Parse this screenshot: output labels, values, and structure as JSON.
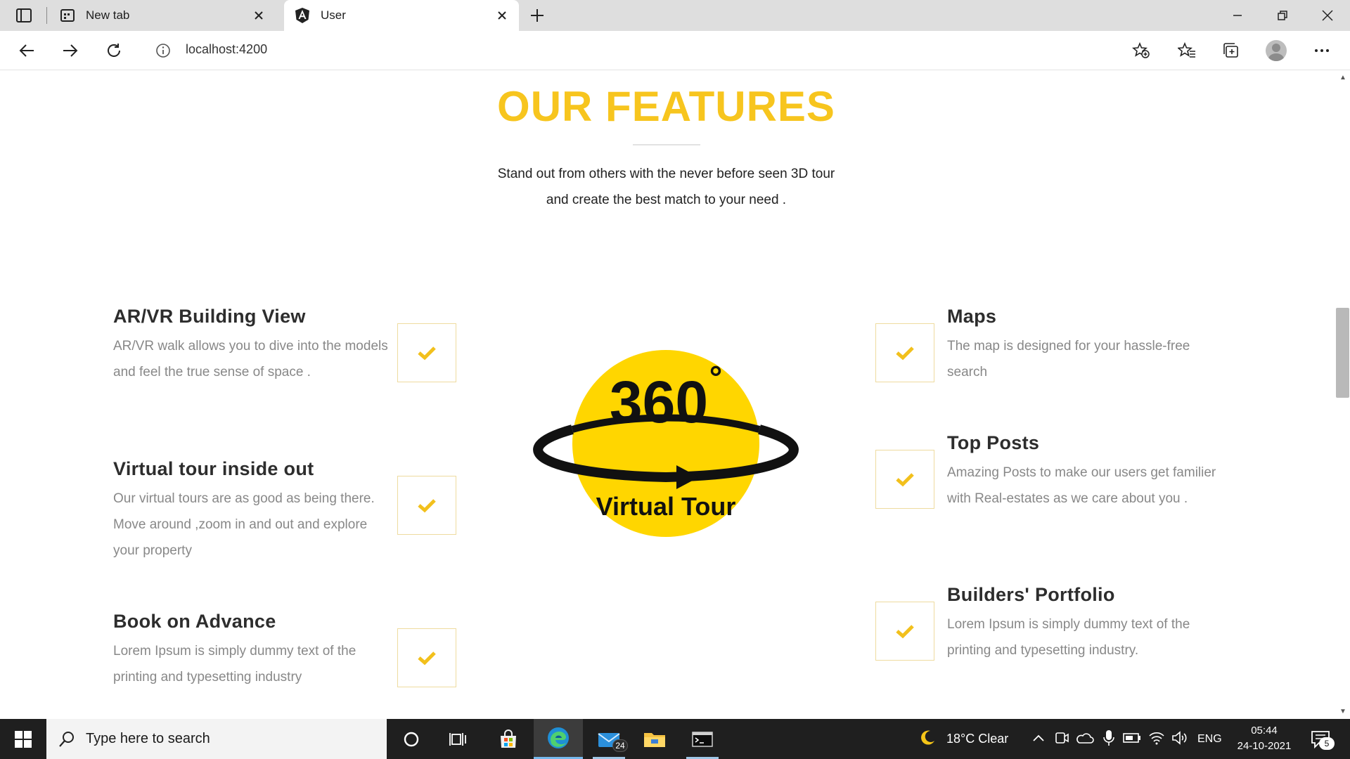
{
  "browser": {
    "tabs": [
      {
        "label": "New tab",
        "active": false
      },
      {
        "label": "User",
        "active": true
      }
    ],
    "url": "localhost:4200"
  },
  "features_section": {
    "title": "OUR FEATURES",
    "subtitle_line1": "Stand out from others with the never before seen 3D tour",
    "subtitle_line2": "and create the best match to your need .",
    "logo": {
      "number": "360",
      "degree": "°",
      "caption": "Virtual Tour"
    },
    "left_features": [
      {
        "title": "AR/VR Building View",
        "text": "AR/VR walk allows you to dive into the models and feel the true sense of space ."
      },
      {
        "title": "Virtual tour inside out",
        "text": "Our virtual tours are as good as being there. Move around ,zoom in and out and explore your property"
      },
      {
        "title": "Book on Advance",
        "text": "Lorem Ipsum is simply dummy text of the printing and typesetting industry"
      }
    ],
    "right_features": [
      {
        "title": "Maps",
        "text": "The map is designed for your hassle-free search"
      },
      {
        "title": "Top Posts",
        "text": "Amazing Posts to make our users get familier with Real-estates as we care about you ."
      },
      {
        "title": "Builders' Portfolio",
        "text": "Lorem Ipsum is simply dummy text of the printing and typesetting industry."
      }
    ],
    "accent_color": "#f7c51e",
    "check_color": "#f2c01c"
  },
  "taskbar": {
    "search_placeholder": "Type here to search",
    "mail_badge": "24",
    "weather": "18°C  Clear",
    "language": "ENG",
    "time": "05:44",
    "date": "24-10-2021",
    "notification_count": "5"
  }
}
